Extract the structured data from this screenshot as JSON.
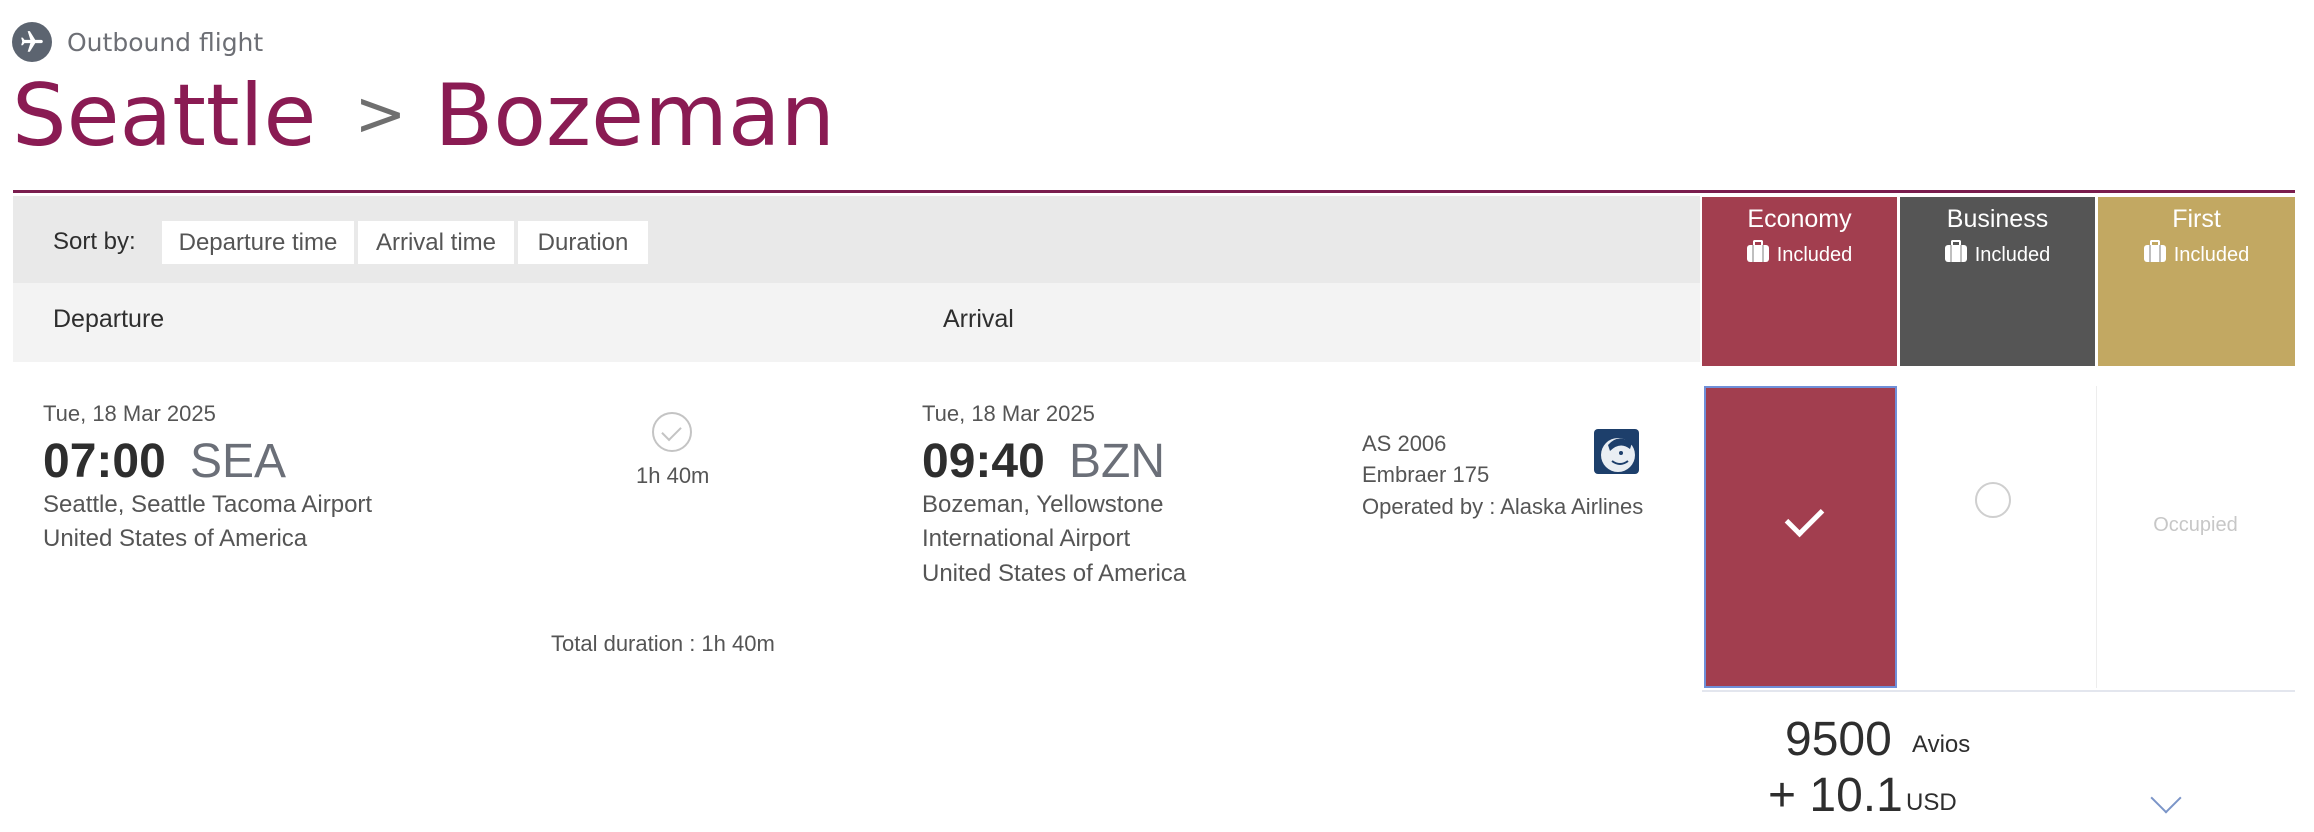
{
  "header": {
    "outbound_label": "Outbound flight",
    "origin_city": "Seattle",
    "destination_city": "Bozeman",
    "separator": ">"
  },
  "sort": {
    "label": "Sort by:",
    "options": [
      "Departure time",
      "Arrival time",
      "Duration"
    ]
  },
  "columns": {
    "departure": "Departure",
    "arrival": "Arrival"
  },
  "cabins": [
    {
      "name": "Economy",
      "baggage": "Included",
      "color": "#a23e4f"
    },
    {
      "name": "Business",
      "baggage": "Included",
      "color": "#555555"
    },
    {
      "name": "First",
      "baggage": "Included",
      "color": "#c2a862"
    }
  ],
  "flight": {
    "departure": {
      "date": "Tue, 18 Mar 2025",
      "time": "07:00",
      "code": "SEA",
      "airport_line1": "Seattle, Seattle Tacoma Airport",
      "country": "United States of America"
    },
    "duration": "1h 40m",
    "arrival": {
      "date": "Tue, 18 Mar 2025",
      "time": "09:40",
      "code": "BZN",
      "airport_line1": "Bozeman, Yellowstone",
      "airport_line2": "International Airport",
      "country": "United States of America"
    },
    "flight_number": "AS 2006",
    "aircraft": "Embraer 175",
    "operated_by": "Operated by : Alaska Airlines",
    "airline_logo_icon": "alaska-airlines-logo",
    "total_duration": "Total duration : 1h 40m"
  },
  "fares": {
    "economy_state": "selected",
    "business_state": "available",
    "first_state": "Occupied"
  },
  "price": {
    "avios": "9500",
    "avios_unit": "Avios",
    "cash": "+ 10.1",
    "cash_unit": "USD"
  },
  "icons": {
    "plane": "airplane-icon",
    "duration": "check-circle-icon",
    "baggage": "suitcase-icon",
    "selected": "checkmark-icon",
    "expand": "chevron-down-icon"
  }
}
